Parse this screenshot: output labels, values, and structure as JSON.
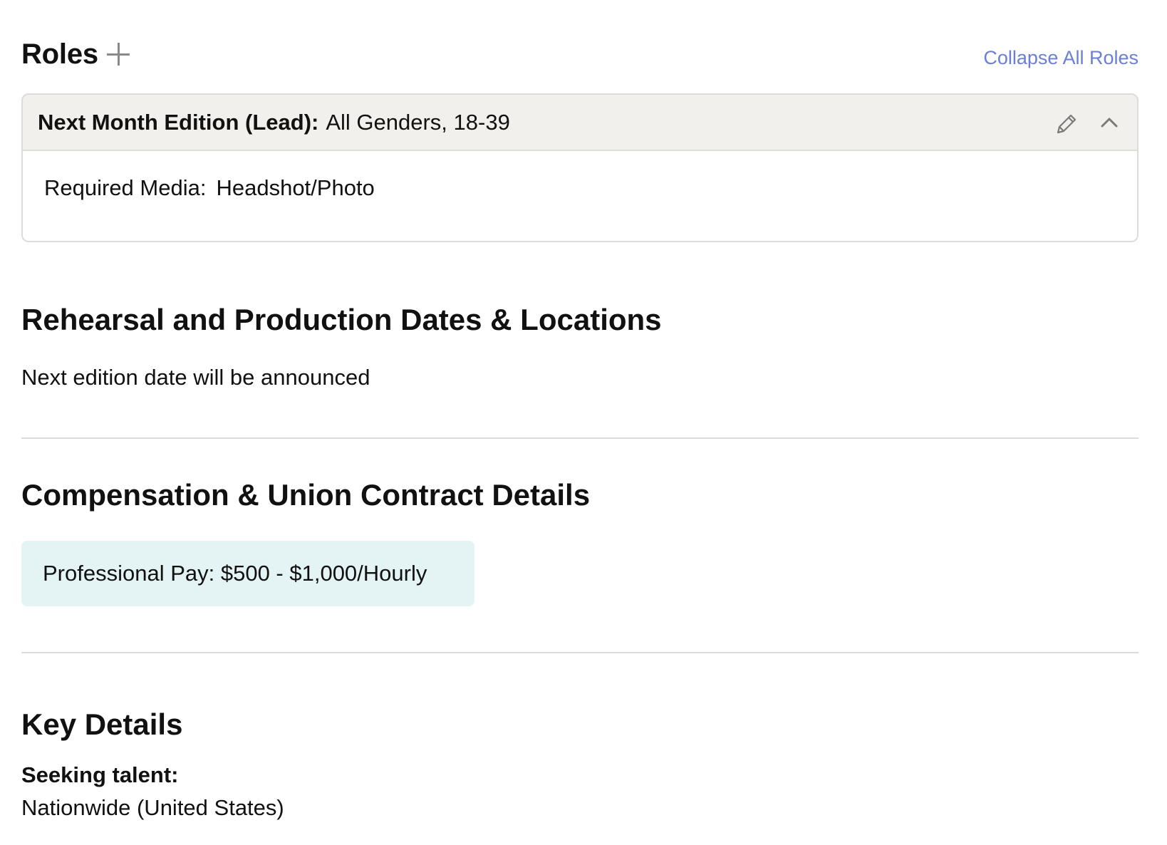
{
  "roles": {
    "title": "Roles",
    "add_icon": "plus-icon",
    "collapse_all_label": "Collapse All Roles",
    "accent_color": "#6b7fd7",
    "items": [
      {
        "name": "Next Month Edition (Lead):",
        "summary": "All Genders, 18-39",
        "required_media_label": "Required Media:",
        "required_media_value": "Headshot/Photo",
        "icons": [
          "pencil-icon",
          "chevron-up-icon"
        ]
      }
    ]
  },
  "rehearsal": {
    "title": "Rehearsal and Production Dates & Locations",
    "text": "Next edition date will be announced"
  },
  "compensation": {
    "title": "Compensation & Union Contract Details",
    "pay": "Professional Pay: $500 - $1,000/Hourly",
    "chip_color": "#e4f3f3"
  },
  "key_details": {
    "title": "Key Details",
    "seeking_label": "Seeking talent:",
    "seeking_value": "Nationwide (United States)"
  }
}
